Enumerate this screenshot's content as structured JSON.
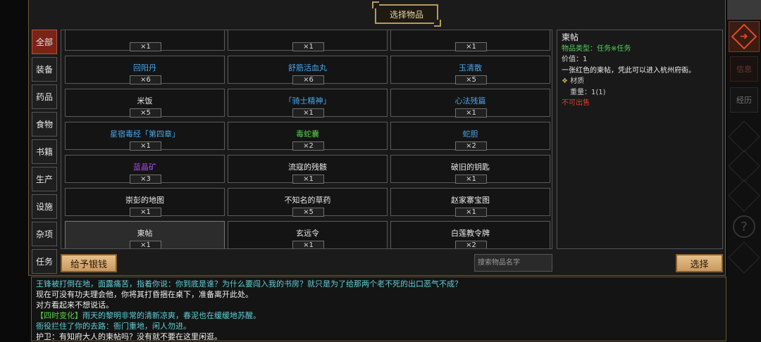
{
  "title": "选择物品",
  "tabs": [
    "全部",
    "装备",
    "药品",
    "食物",
    "书籍",
    "生产",
    "设施",
    "杂项",
    "任务"
  ],
  "items": [
    {
      "name": "",
      "qty": "×1",
      "color": "#dddddd"
    },
    {
      "name": "",
      "qty": "×1",
      "color": "#dddddd"
    },
    {
      "name": "",
      "qty": "×1",
      "color": "#dddddd"
    },
    {
      "name": "回阳丹",
      "qty": "×6",
      "color": "#4aa6e8"
    },
    {
      "name": "舒筋活血丸",
      "qty": "×6",
      "color": "#4aa6e8"
    },
    {
      "name": "玉清散",
      "qty": "×5",
      "color": "#4aa6e8"
    },
    {
      "name": "米饭",
      "qty": "×5",
      "color": "#e8e8e8"
    },
    {
      "name": "「骑士精神」",
      "qty": "×1",
      "color": "#4aa6e8"
    },
    {
      "name": "心法残篇",
      "qty": "×1",
      "color": "#4aa6e8"
    },
    {
      "name": "星宿毒经「第四章」",
      "qty": "×1",
      "color": "#4aa6e8"
    },
    {
      "name": "毒蛇囊",
      "qty": "×2",
      "color": "#59d04a"
    },
    {
      "name": "蛇胆",
      "qty": "×2",
      "color": "#4aa6e8"
    },
    {
      "name": "蓝晶矿",
      "qty": "×3",
      "color": "#a64ae8"
    },
    {
      "name": "流寇的残骸",
      "qty": "×1",
      "color": "#e8e8e8"
    },
    {
      "name": "破旧的钥匙",
      "qty": "×1",
      "color": "#e8e8e8"
    },
    {
      "name": "崇彭的地图",
      "qty": "×1",
      "color": "#e8e8e8"
    },
    {
      "name": "不知名的草药",
      "qty": "×5",
      "color": "#e8e8e8"
    },
    {
      "name": "赵家寨宝图",
      "qty": "×1",
      "color": "#e8e8e8"
    },
    {
      "name": "柬帖",
      "qty": "×1",
      "color": "#e8e8e8"
    },
    {
      "name": "玄远令",
      "qty": "×1",
      "color": "#e8e8e8"
    },
    {
      "name": "白莲教令牌",
      "qty": "×2",
      "color": "#e8e8e8"
    }
  ],
  "detail": {
    "name": "柬帖",
    "type": "物品类型：任务※任务",
    "value": "价值：1",
    "description": "一张红色的柬帖，凭此可以进入杭州府衙。",
    "material_label": "材质",
    "weight": "重量：1(1)",
    "sell_status": "不可出售"
  },
  "buttons": {
    "give_money": "给予银钱",
    "select": "选择"
  },
  "search": {
    "placeholder": "搜索物品名字"
  },
  "log": [
    {
      "text": "王锋被打倒在地，面露痛苦，指着你说：你到底是谁？为什么要闯入我的书房？就只是为了给那两个老不死的出口恶气不成？",
      "color": "cyan"
    },
    {
      "text": "现在可没有功夫理会他，你将其打昏捆在桌下，准备离开此处。",
      "color": "white"
    },
    {
      "text": "对方看起来不想说话。",
      "color": "white"
    },
    {
      "tag": "【四时变化】",
      "text": "雨天的黎明非常的清新凉爽，春泥也在缓缓地苏醒。",
      "color": "cyan"
    },
    {
      "text": "衙役拦住了你的去路：衙门重地，闲人勿进。",
      "color": "cyan"
    },
    {
      "text": "护卫：有知府大人的柬帖吗？没有就不要在这里闲逛。",
      "color": "white"
    }
  ],
  "rail": {
    "info_label": "信息",
    "log_label": "经历",
    "help_glyph": "?",
    "back_glyph": "➜"
  },
  "colors": {
    "accent": "#7a2418",
    "button": "#d8ae74",
    "border": "#6a5a3a"
  }
}
